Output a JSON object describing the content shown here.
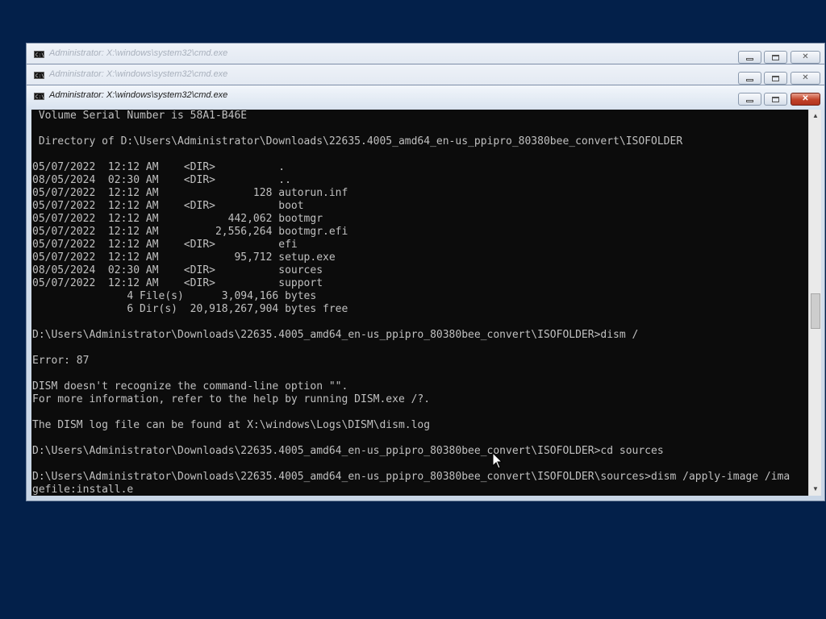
{
  "windows": [
    {
      "title": "Administrator: X:\\windows\\system32\\cmd.exe",
      "state": "inactive"
    },
    {
      "title": "Administrator: X:\\windows\\system32\\cmd.exe",
      "state": "inactive"
    },
    {
      "title": "Administrator: X:\\windows\\system32\\cmd.exe",
      "state": "active"
    }
  ],
  "app_icon_text": "C:\\",
  "caption_buttons": {
    "close": "✕"
  },
  "colors": {
    "desktop": "#03204a",
    "console_bg": "#0c0c0c",
    "console_fg": "#c0c0c0",
    "close_button": "#c1432a"
  },
  "console": {
    "lines": [
      " Volume Serial Number is 58A1-B46E",
      "",
      " Directory of D:\\Users\\Administrator\\Downloads\\22635.4005_amd64_en-us_ppipro_80380bee_convert\\ISOFOLDER",
      "",
      "05/07/2022  12:12 AM    <DIR>          .",
      "08/05/2024  02:30 AM    <DIR>          ..",
      "05/07/2022  12:12 AM               128 autorun.inf",
      "05/07/2022  12:12 AM    <DIR>          boot",
      "05/07/2022  12:12 AM           442,062 bootmgr",
      "05/07/2022  12:12 AM         2,556,264 bootmgr.efi",
      "05/07/2022  12:12 AM    <DIR>          efi",
      "05/07/2022  12:12 AM            95,712 setup.exe",
      "08/05/2024  02:30 AM    <DIR>          sources",
      "05/07/2022  12:12 AM    <DIR>          support",
      "               4 File(s)      3,094,166 bytes",
      "               6 Dir(s)  20,918,267,904 bytes free",
      "",
      "D:\\Users\\Administrator\\Downloads\\22635.4005_amd64_en-us_ppipro_80380bee_convert\\ISOFOLDER>dism /",
      "",
      "Error: 87",
      "",
      "DISM doesn't recognize the command-line option \"\".",
      "For more information, refer to the help by running DISM.exe /?.",
      "",
      "The DISM log file can be found at X:\\windows\\Logs\\DISM\\dism.log",
      "",
      "D:\\Users\\Administrator\\Downloads\\22635.4005_amd64_en-us_ppipro_80380bee_convert\\ISOFOLDER>cd sources",
      "",
      "D:\\Users\\Administrator\\Downloads\\22635.4005_amd64_en-us_ppipro_80380bee_convert\\ISOFOLDER\\sources>dism /apply-image /ima",
      "gefile:install.e"
    ]
  }
}
